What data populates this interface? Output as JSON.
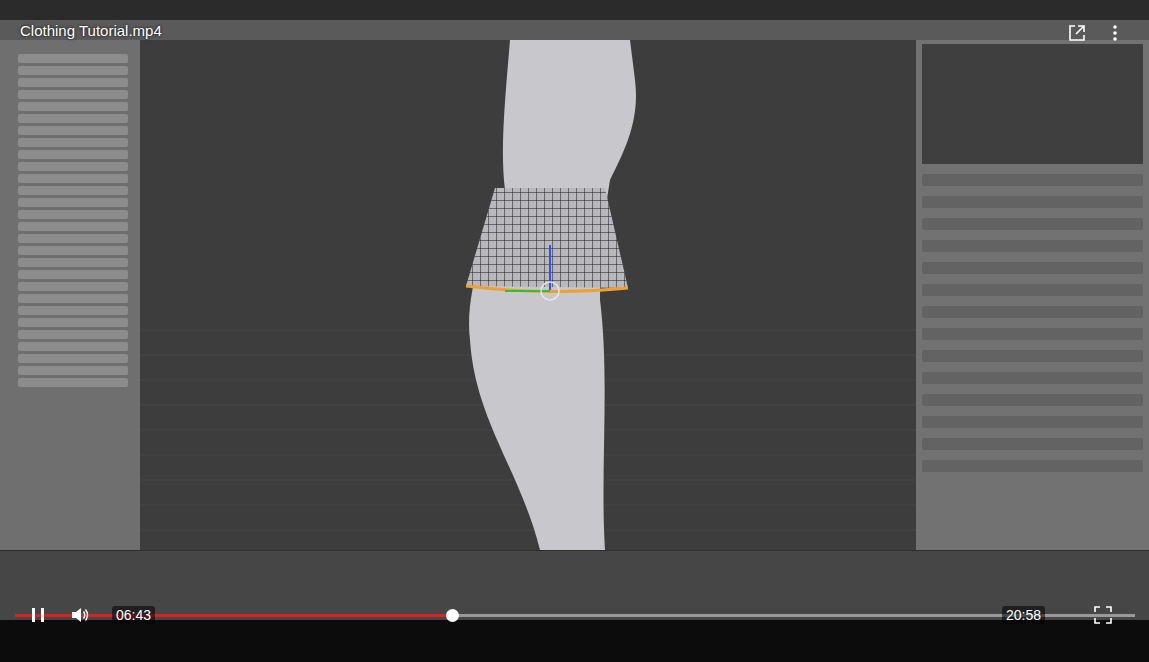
{
  "player": {
    "title": "Clothing Tutorial.mp4",
    "playing": true,
    "current_time": "06:43",
    "duration": "20:58",
    "level": 0.39
  }
}
